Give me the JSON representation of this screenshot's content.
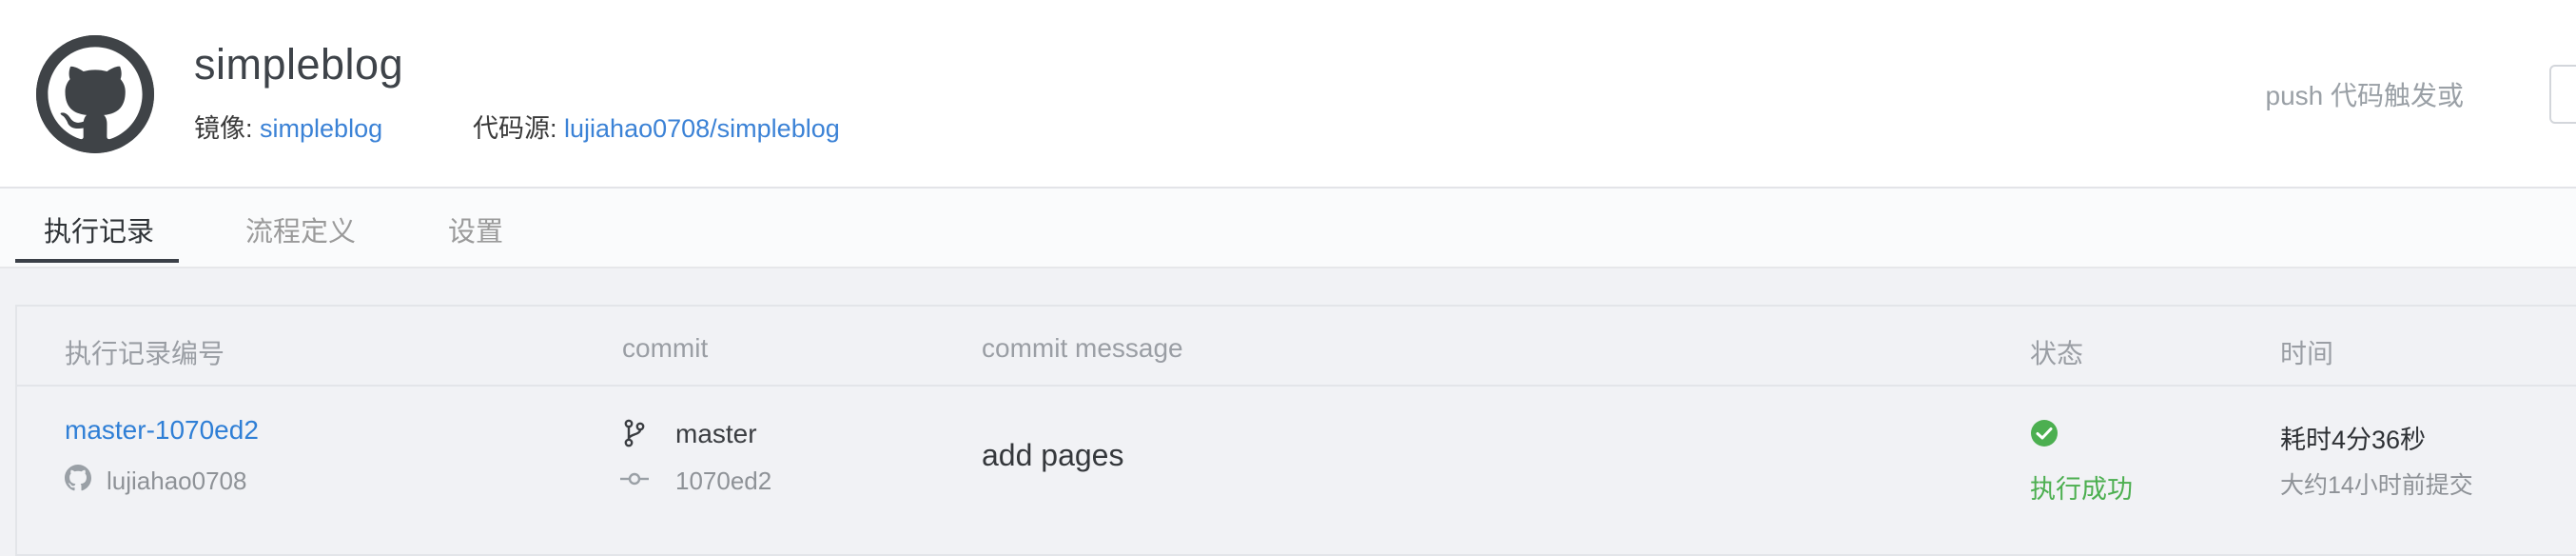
{
  "header": {
    "repo_name": "simpleblog",
    "image_label": "镜像:",
    "image_value": "simpleblog",
    "source_label": "代码源:",
    "source_value": "lujiahao0708/simpleblog",
    "trigger_text": "push 代码触发或"
  },
  "tabs": [
    {
      "label": "执行记录",
      "active": true
    },
    {
      "label": "流程定义",
      "active": false
    },
    {
      "label": "设置",
      "active": false
    }
  ],
  "table": {
    "columns": [
      "执行记录编号",
      "commit",
      "commit message",
      "状态",
      "时间"
    ],
    "rows": [
      {
        "run_id": "master-1070ed2",
        "author": "lujiahao0708",
        "branch": "master",
        "sha": "1070ed2",
        "message": "add pages",
        "status": "执行成功",
        "duration": "耗时4分36秒",
        "submitted": "大约14小时前提交"
      }
    ]
  },
  "colors": {
    "link": "#3b82d6",
    "success": "#4caf50",
    "tab_active_underline": "#3b4048",
    "logo_bg": "#3f4347"
  },
  "icons": {
    "logo": "github-octocat-icon",
    "author": "github-icon",
    "branch": "git-branch-icon",
    "commit": "git-commit-icon",
    "status": "check-circle-icon"
  }
}
